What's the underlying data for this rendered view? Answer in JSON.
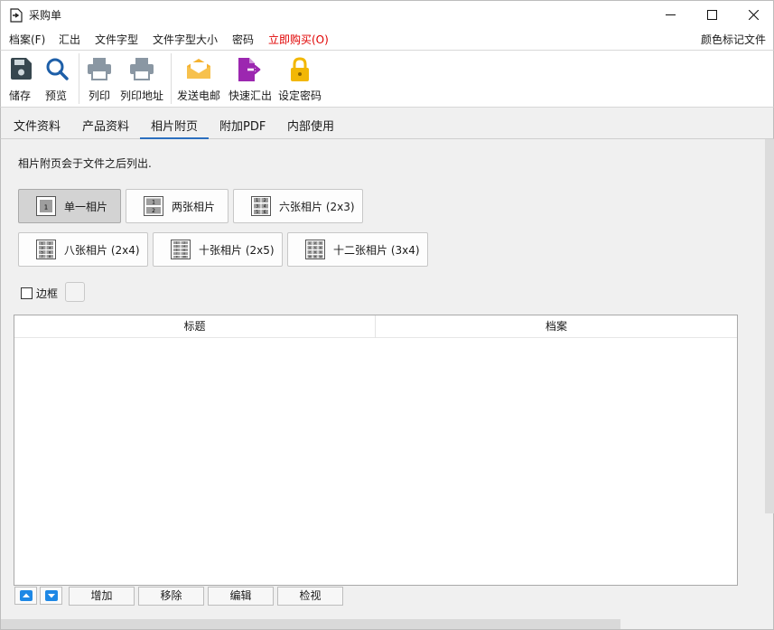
{
  "window": {
    "title": "采购单"
  },
  "menu": {
    "items": [
      {
        "label": "档案(F)"
      },
      {
        "label": "汇出"
      },
      {
        "label": "文件字型"
      },
      {
        "label": "文件字型大小"
      },
      {
        "label": "密码"
      },
      {
        "label": "立即购买(O)",
        "color": "#e00000"
      }
    ],
    "right_label": "颜色标记文件"
  },
  "toolbar": {
    "items": [
      {
        "label": "储存",
        "icon": "save-icon"
      },
      {
        "label": "预览",
        "icon": "magnifier-icon"
      },
      {
        "label": "列印",
        "icon": "printer-icon"
      },
      {
        "label": "列印地址",
        "icon": "printer-icon"
      },
      {
        "label": "发送电邮",
        "icon": "envelope-icon"
      },
      {
        "label": "快速汇出",
        "icon": "file-export-icon"
      },
      {
        "label": "设定密码",
        "icon": "padlock-icon"
      }
    ]
  },
  "tabs": [
    {
      "label": "文件资料"
    },
    {
      "label": "产品资料"
    },
    {
      "label": "相片附页",
      "active": true
    },
    {
      "label": "附加PDF"
    },
    {
      "label": "内部使用"
    }
  ],
  "photos": {
    "note": "相片附页会于文件之后列出.",
    "layouts": [
      {
        "label": "单一相片",
        "selected": true,
        "icon": "single-photo-icon",
        "cells": [
          "1"
        ]
      },
      {
        "label": "两张相片",
        "icon": "two-photos-icon",
        "cells": [
          "1",
          "2"
        ]
      },
      {
        "label": "六张相片 (2x3)",
        "icon": "six-photos-icon",
        "cells": [
          "1",
          "2",
          "3",
          "4",
          "5",
          "6"
        ]
      },
      {
        "label": "八张相片 (2x4)",
        "icon": "eight-photos-icon",
        "cells": [
          "1",
          "2",
          "3",
          "4",
          "5",
          "6",
          "7",
          "8"
        ]
      },
      {
        "label": "十张相片 (2x5)",
        "icon": "ten-photos-icon",
        "cells": [
          "1",
          "2",
          "3",
          "4",
          "5",
          "6",
          "7",
          "8",
          "9",
          "10"
        ]
      },
      {
        "label": "十二张相片 (3x4)",
        "icon": "twelve-photos-icon",
        "cells": [
          "1",
          "2",
          "3",
          "4",
          "5",
          "6",
          "7",
          "8",
          "9",
          "10",
          "11",
          "12"
        ]
      }
    ],
    "border_label": "边框",
    "border_checked": false
  },
  "table": {
    "columns": [
      "标题",
      "档案"
    ],
    "rows": []
  },
  "actions": {
    "add": "增加",
    "remove": "移除",
    "edit": "编辑",
    "view": "检视"
  },
  "colors": {
    "accent": "#2b6fbf",
    "save": "#37474f",
    "search": "#1e5fa8",
    "printer": "#8a97a3",
    "envelope": "#f5b230",
    "export": "#9c27b0",
    "lock": "#f2b705",
    "arrow": "#1e88e5"
  }
}
